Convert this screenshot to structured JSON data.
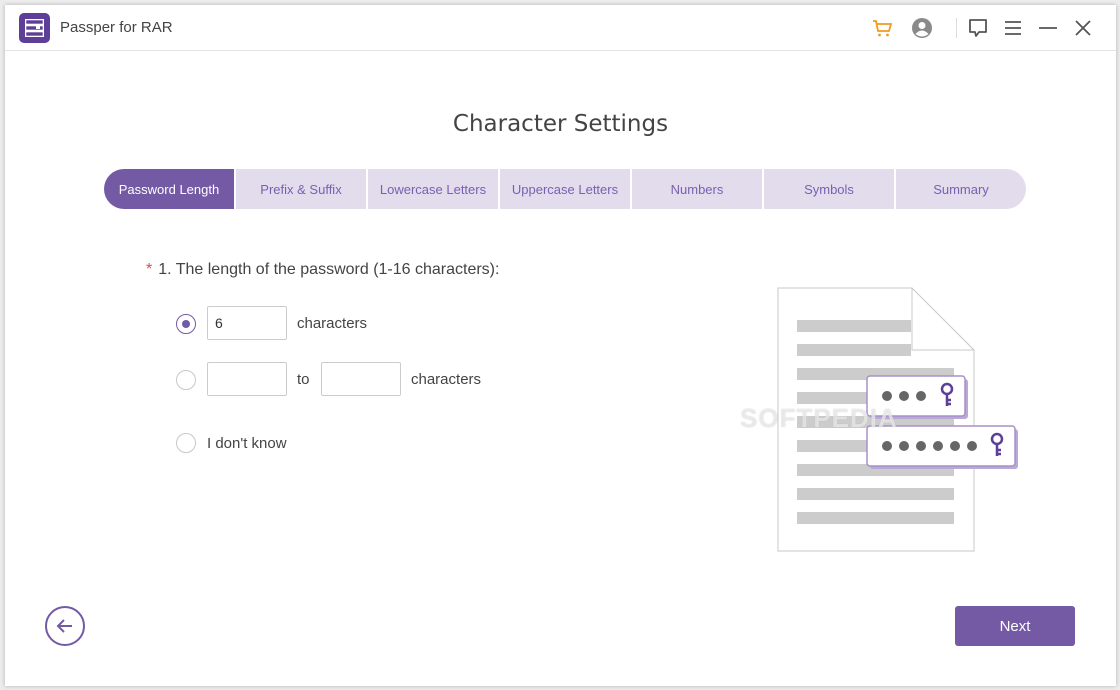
{
  "app": {
    "title": "Passper for RAR",
    "logo_icon": "archive-icon"
  },
  "titlebar": {
    "icons": [
      "cart-icon",
      "account-icon",
      "feedback-icon",
      "menu-icon",
      "minimize-icon",
      "close-icon"
    ],
    "cart_color": "#f39a1e"
  },
  "page": {
    "title": "Character Settings"
  },
  "steps": [
    {
      "label": "Password Length",
      "active": true
    },
    {
      "label": "Prefix & Suffix",
      "active": false
    },
    {
      "label": "Lowercase Letters",
      "active": false
    },
    {
      "label": "Uppercase Letters",
      "active": false
    },
    {
      "label": "Numbers",
      "active": false
    },
    {
      "label": "Symbols",
      "active": false
    },
    {
      "label": "Summary",
      "active": false
    }
  ],
  "question": {
    "required_mark": "*",
    "text": "1. The length of the password (1-16 characters):"
  },
  "options": {
    "exact": {
      "selected": true,
      "value": "6",
      "suffix": "characters"
    },
    "range": {
      "selected": false,
      "from": "",
      "to_label": "to",
      "to": "",
      "suffix": "characters"
    },
    "unknown": {
      "selected": false,
      "label": "I don't know"
    }
  },
  "illustration": {
    "short_password_dots": 3,
    "long_password_dots": 6
  },
  "watermark": "SOFTPEDIA",
  "footer": {
    "back_icon": "arrow-left-icon",
    "next_label": "Next"
  },
  "colors": {
    "accent": "#7459a5",
    "step_inactive_bg": "#e2dced",
    "step_inactive_text": "#7b5fb0",
    "required": "#e04848"
  }
}
